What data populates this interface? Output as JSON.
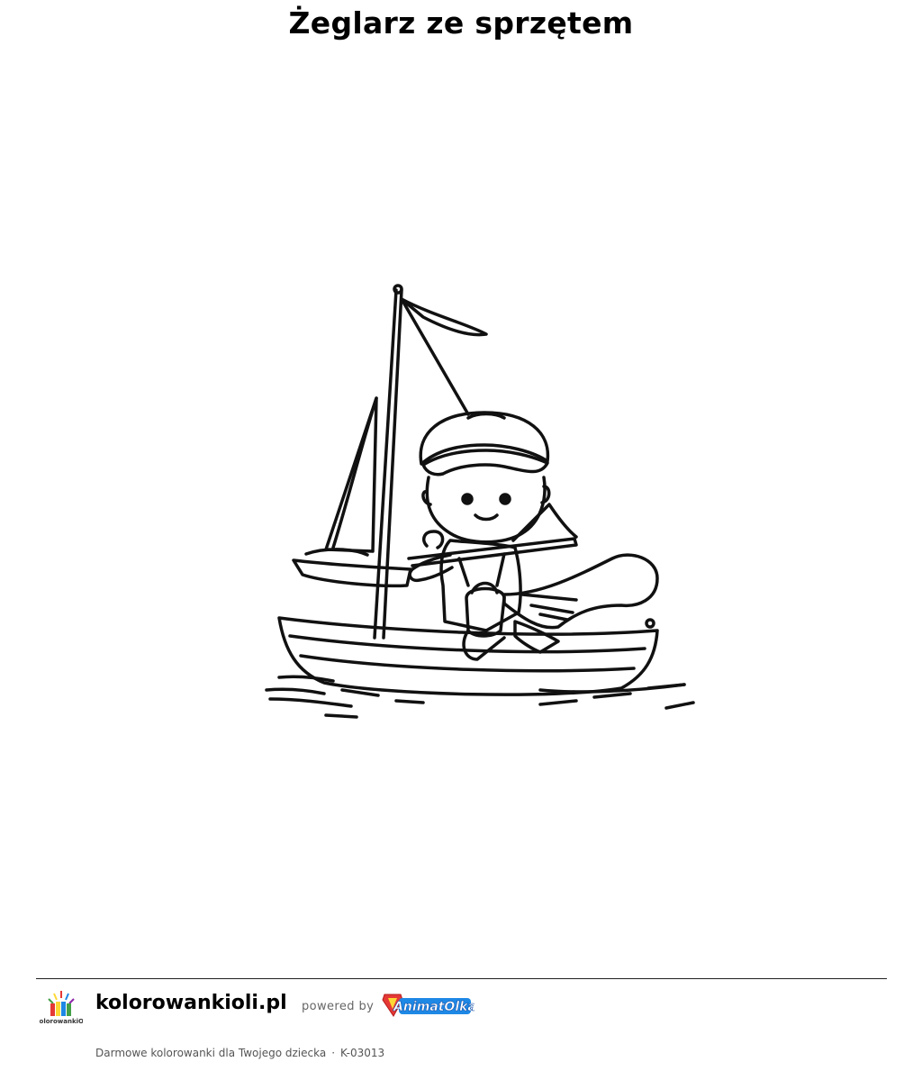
{
  "page": {
    "title": "Żeglarz ze sprzętem"
  },
  "artwork": {
    "icon": "boy-sailing-boat-coloring-illustration"
  },
  "footer": {
    "logo_icon": "kolorowankioli-logo",
    "logo_text": "KolorowankiOli",
    "site_name": "kolorowankioli.pl",
    "powered_by": "powered by",
    "brand_icon": "animatolka-logo",
    "brand_text": "AnimatOlka",
    "tagline": "Darmowe kolorowanki dla Twojego dziecka",
    "separator": "·",
    "code": "K-03013"
  },
  "colors": {
    "brand_red": "#e53935",
    "brand_blue": "#1e88e5",
    "brand_yellow": "#fdd835"
  }
}
